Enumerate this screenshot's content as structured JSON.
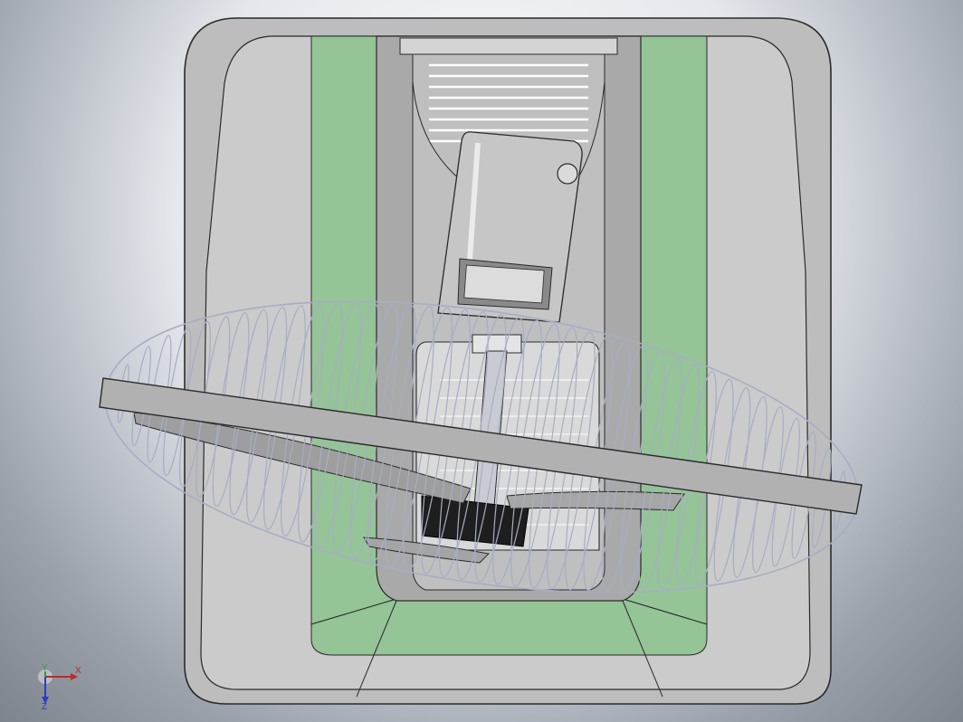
{
  "view": {
    "background_center": "#ffffff",
    "background_edge": "#7d848e"
  },
  "model": {
    "body_color": "#b9b9b9",
    "panel_color": "#c9c9c9",
    "tray_color": "#96c59a",
    "edge_color": "#2a2a2a",
    "wire_color": "#a7adc4",
    "motor_color": "#c4c4c4",
    "dark_part_color": "#222222",
    "cage_ribs": 41
  },
  "triad": {
    "x_label": "X",
    "y_label": "Y",
    "z_label": "Z",
    "x_color": "#c0282a",
    "y_color": "#2f9e3a",
    "z_color": "#2b3fbd"
  }
}
